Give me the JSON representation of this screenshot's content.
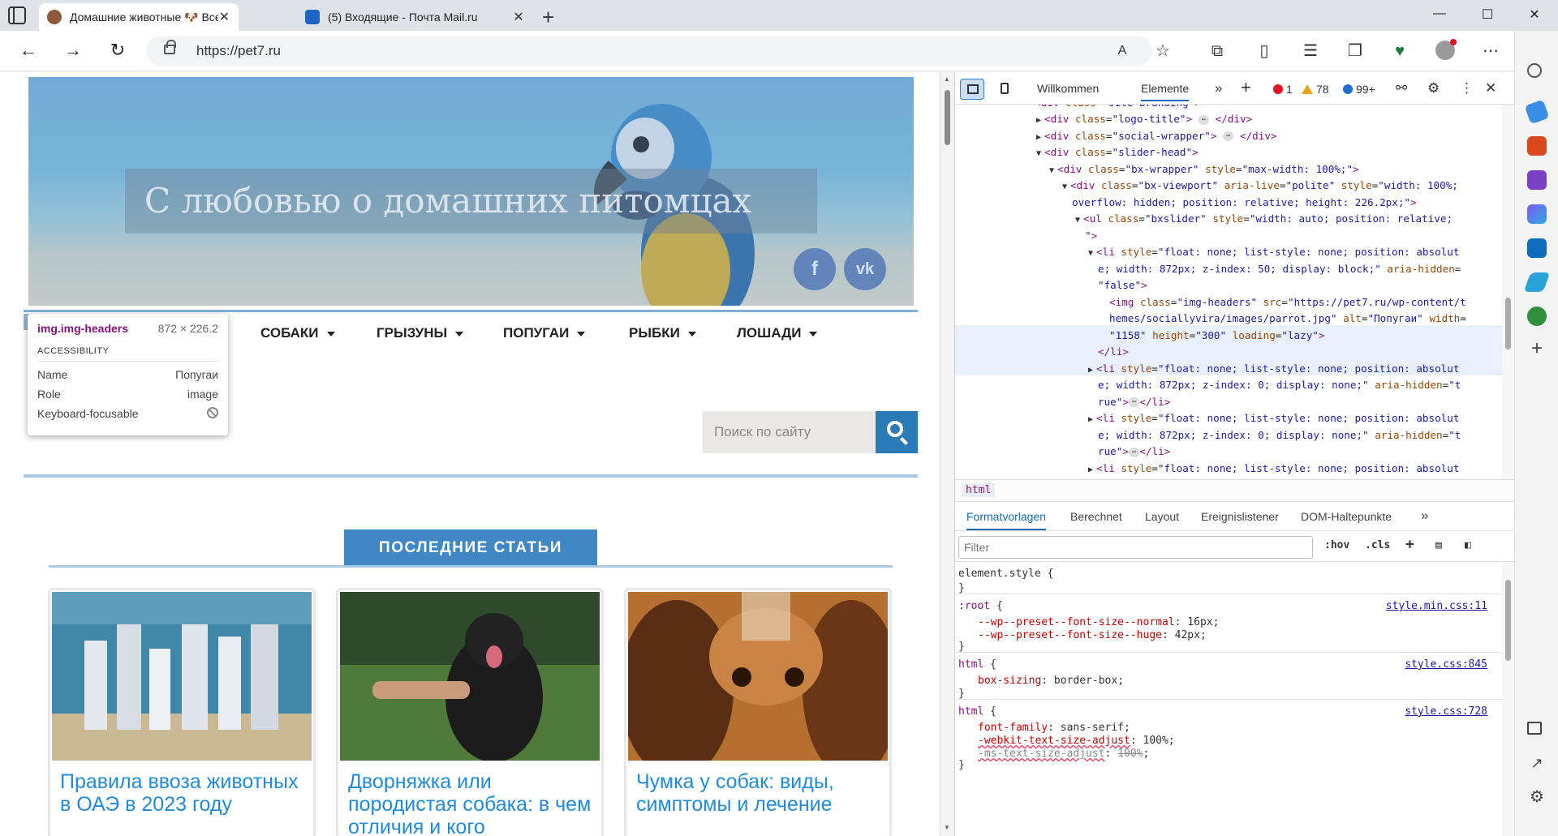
{
  "browser": {
    "tabs": [
      {
        "label": "Домашние животные 🐶 Все пр",
        "active": true
      },
      {
        "label": "(5) Входящие - Почта Mail.ru",
        "active": false
      }
    ],
    "url_host": "https://pet7.ru",
    "window_controls": [
      "—",
      "☐",
      "✕"
    ]
  },
  "page": {
    "header_title": "С любовью о домашних питомцах",
    "social": [
      {
        "label": "f",
        "name": "facebook"
      },
      {
        "label": "vk",
        "name": "vk"
      }
    ],
    "menu": [
      "СОБАКИ",
      "ГРЫЗУНЫ",
      "ПОПУГАИ",
      "РЫБКИ",
      "ЛОШАДИ"
    ],
    "search_placeholder": "Поиск по сайту",
    "latest_label": "ПОСЛЕДНИЕ СТАТЬИ",
    "cards": [
      {
        "title": "Правила ввоза животных в ОАЭ в 2023 году"
      },
      {
        "title": "Дворняжка или породистая собака: в чем отличия и кого"
      },
      {
        "title": "Чумка у собак: виды, симптомы и лечение"
      }
    ]
  },
  "inspector_tooltip": {
    "selector": "img.img-headers",
    "dims": "872 × 226.2",
    "section": "ACCESSIBILITY",
    "rows": [
      {
        "key": "Name",
        "value": "Попугаи"
      },
      {
        "key": "Role",
        "value": "image"
      },
      {
        "key": "Keyboard-focusable",
        "value": ""
      }
    ]
  },
  "devtools": {
    "tabs": [
      "Willkommen",
      "Elemente"
    ],
    "active_tab": "Elemente",
    "errors": "1",
    "warnings": "78",
    "info": "99+",
    "breadcrumb": "html",
    "style_tabs": [
      "Formatvorlagen",
      "Berechnet",
      "Layout",
      "Ereignislistener",
      "DOM-Haltepunkte"
    ],
    "filter_placeholder": "Filter",
    "filter_buttons": [
      ":hov",
      ".cls"
    ],
    "colors": {
      "error": "#e81123",
      "warning": "#e8a317",
      "info": "#1f6fd0",
      "accent": "#0f6cbd"
    }
  }
}
